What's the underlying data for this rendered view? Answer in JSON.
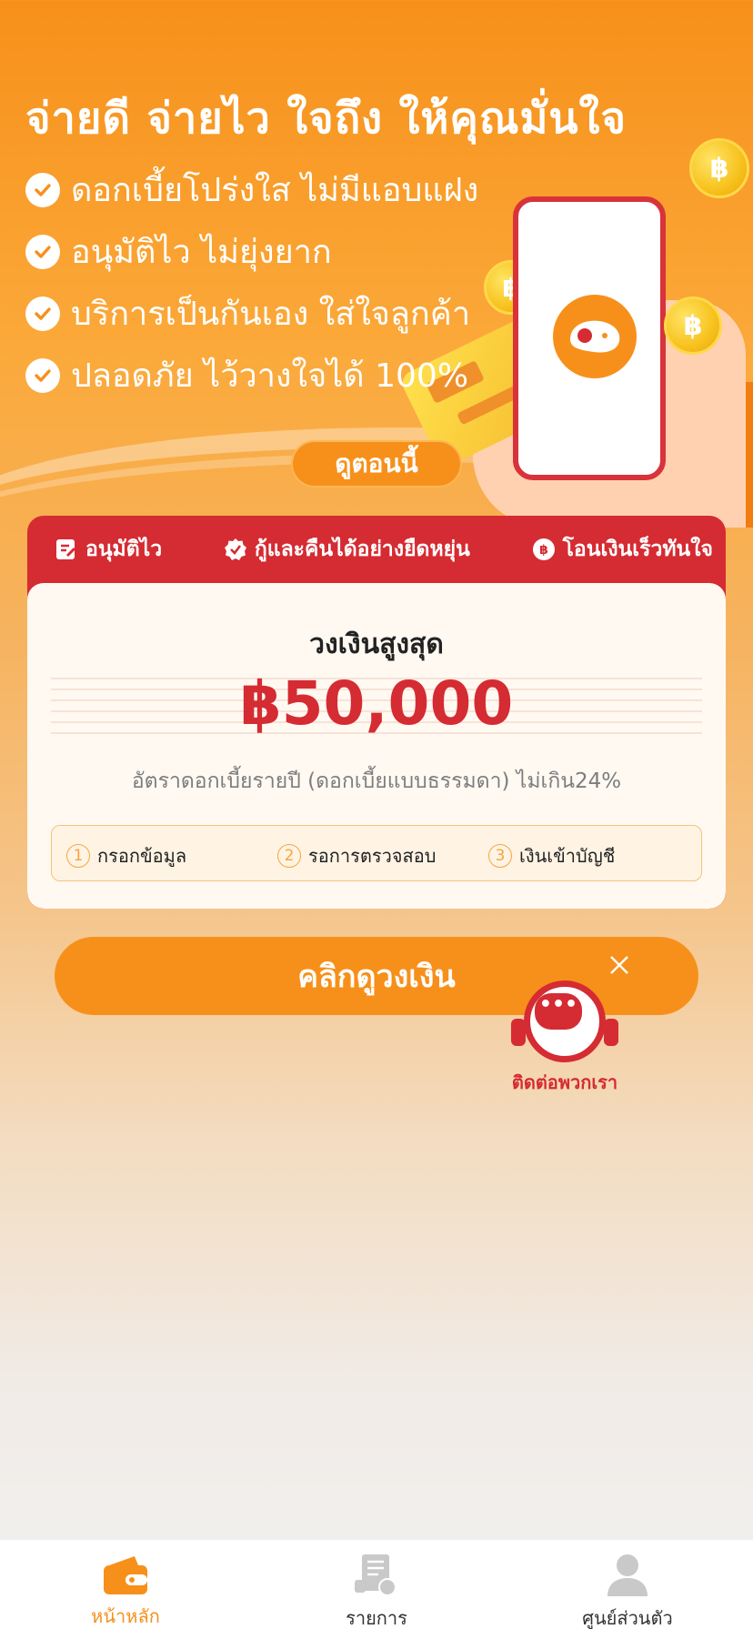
{
  "hero": {
    "title": "จ่ายดี จ่ายไว ใจถึง ให้คุณมั่นใจ",
    "features": [
      "ดอกเบี้ยโปร่งใส ไม่มีแอบแฝง",
      "อนุมัติไว ไม่ยุ่งยาก",
      "บริการเป็นกันเอง ใส่ใจลูกค้า",
      "ปลอดภัย ไว้วางใจได้ 100%"
    ],
    "view_button": "ดูตอนนี้",
    "coin_symbol": "฿"
  },
  "card": {
    "header": {
      "items": [
        "อนุมัติไว",
        "กู้และคืนได้อย่างยืดหยุ่น",
        "โอนเงินเร็วทันใจ"
      ]
    },
    "limit_label": "วงเงินสูงสุด",
    "amount": "฿50,000",
    "rate_text": "อัตราดอกเบี้ยรายปี (ดอกเบี้ยแบบธรรมดา) ไม่เกิน24%",
    "steps": [
      {
        "num": "1",
        "label": "กรอกข้อมูล"
      },
      {
        "num": "2",
        "label": "รอการตรวจสอบ"
      },
      {
        "num": "3",
        "label": "เงินเข้าบัญชี"
      }
    ]
  },
  "cta": {
    "label": "คลิกดูวงเงิน"
  },
  "support": {
    "label": "ติดต่อพวกเรา"
  },
  "tabbar": {
    "items": [
      {
        "label": "หน้าหลัก",
        "icon": "wallet-icon",
        "active": true
      },
      {
        "label": "รายการ",
        "icon": "document-icon",
        "active": false
      },
      {
        "label": "ศูนย์ส่วนตัว",
        "icon": "user-icon",
        "active": false
      }
    ]
  },
  "colors": {
    "primary_orange": "#f7901a",
    "brand_red": "#d52b32",
    "coin_yellow": "#f7c21d"
  }
}
